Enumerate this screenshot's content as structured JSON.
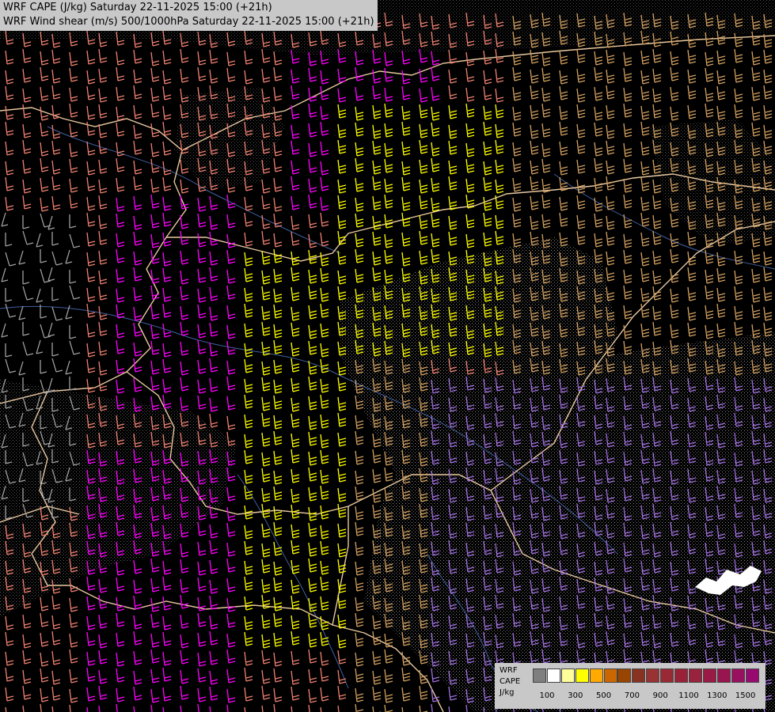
{
  "header": {
    "line1": "WRF CAPE (J/kg) Saturday 22-11-2025 15:00 (+21h)",
    "line2": "WRF Wind shear (m/s) 500/1000hPa Saturday 22-11-2025 15:00 (+21h)"
  },
  "legend": {
    "label_lines": [
      "WRF",
      "CAPE",
      "J/kg"
    ],
    "swatch_colors": [
      "#7f7f7f",
      "#ffffff",
      "#ffff99",
      "#ffff00",
      "#ffaa00",
      "#cc6600",
      "#994400",
      "#883322",
      "#993333",
      "#992a35",
      "#992238",
      "#99223c",
      "#991a45",
      "#99154f",
      "#991060",
      "#990a70"
    ],
    "ticks": [
      "100",
      "300",
      "500",
      "700",
      "900",
      "1100",
      "1300",
      "1500"
    ]
  },
  "colors": {
    "background": "#000000",
    "shear_magenta": "#ff00ff",
    "shear_salmon": "#f08070",
    "shear_yellow": "#ffff00",
    "shear_tan": "#d2a060",
    "shear_purple": "#a070e0",
    "shear_gray": "#a0a0a0",
    "border": "#e8c8a0",
    "river": "#4060a0"
  }
}
